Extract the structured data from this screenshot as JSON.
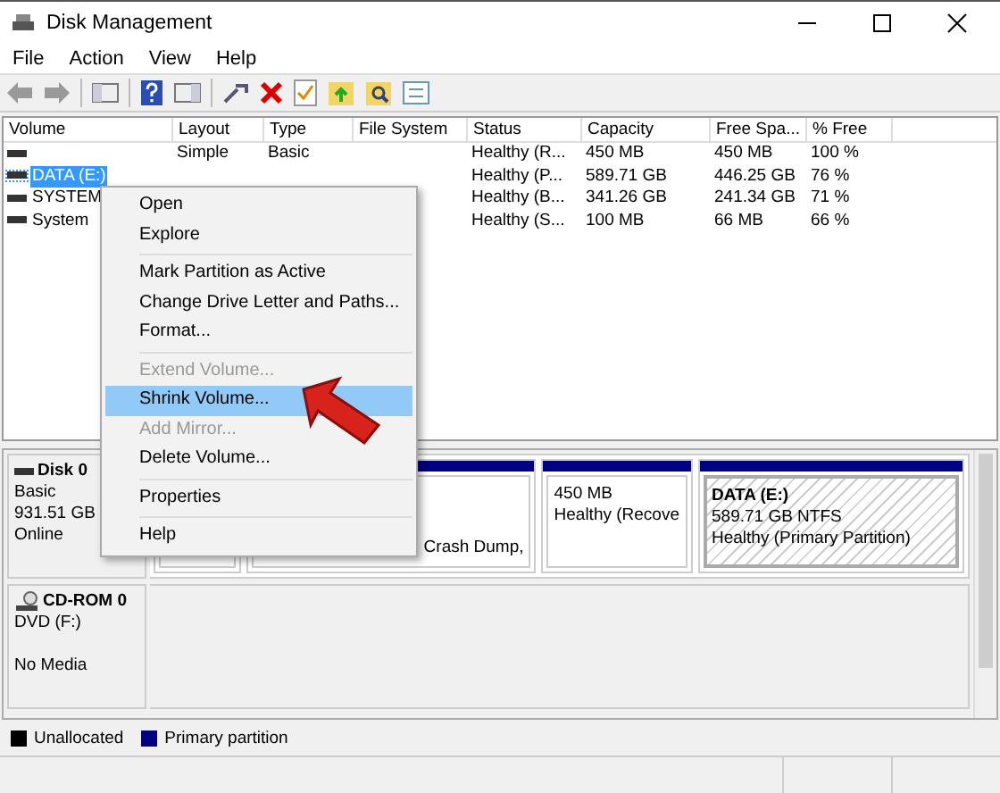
{
  "window": {
    "title": "Disk Management"
  },
  "menu_bar": [
    "File",
    "Action",
    "View",
    "Help"
  ],
  "volume_table": {
    "columns": [
      "Volume",
      "Layout",
      "Type",
      "File System",
      "Status",
      "Capacity",
      "Free Spa...",
      "% Free"
    ],
    "rows": [
      {
        "volume": null,
        "layout": "Simple",
        "type": "Basic",
        "file_system": null,
        "status": "Healthy (R...",
        "capacity": "450 MB",
        "free_space": "450 MB",
        "percent_free": "100 %",
        "selected": false
      },
      {
        "volume": "DATA (E:)",
        "status": "Healthy (P...",
        "capacity": "589.71 GB",
        "free_space": "446.25 GB",
        "percent_free": "76 %",
        "selected": true
      },
      {
        "volume": "SYSTEM",
        "status": "Healthy (B...",
        "capacity": "341.26 GB",
        "free_space": "241.34 GB",
        "percent_free": "71 %",
        "selected": false
      },
      {
        "volume": "System",
        "status": "Healthy (S...",
        "capacity": "100 MB",
        "free_space": "66 MB",
        "percent_free": "66 %",
        "selected": false
      }
    ]
  },
  "context_menu": [
    {
      "kind": "item",
      "label": "Open",
      "disabled": false,
      "selected": false
    },
    {
      "kind": "item",
      "label": "Explore",
      "disabled": false,
      "selected": false
    },
    {
      "kind": "separator"
    },
    {
      "kind": "item",
      "label": "Mark Partition as Active",
      "disabled": false,
      "selected": false
    },
    {
      "kind": "item",
      "label": "Change Drive Letter and Paths...",
      "disabled": false,
      "selected": false
    },
    {
      "kind": "item",
      "label": "Format...",
      "disabled": false,
      "selected": false
    },
    {
      "kind": "separator"
    },
    {
      "kind": "item",
      "label": "Extend Volume...",
      "disabled": true,
      "selected": false
    },
    {
      "kind": "item",
      "label": "Shrink Volume...",
      "disabled": false,
      "selected": true
    },
    {
      "kind": "item",
      "label": "Add Mirror...",
      "disabled": true,
      "selected": false
    },
    {
      "kind": "item",
      "label": "Delete Volume...",
      "disabled": false,
      "selected": false
    },
    {
      "kind": "separator"
    },
    {
      "kind": "item",
      "label": "Properties",
      "disabled": false,
      "selected": false
    },
    {
      "kind": "separator"
    },
    {
      "kind": "item",
      "label": "Help",
      "disabled": false,
      "selected": false
    }
  ],
  "disks": [
    {
      "kind": "disk",
      "name": "Disk 0",
      "lines": [
        "Basic",
        "931.51 GB",
        "Online"
      ],
      "partitions": [
        {
          "selected": false
        },
        {
          "lines": [
            "Crash Dump,"
          ],
          "selected": false
        },
        {
          "lines": [
            "450 MB",
            "Healthy (Recove"
          ],
          "selected": false
        },
        {
          "title": "DATA  (E:)",
          "lines": [
            "589.71 GB NTFS",
            "Healthy (Primary Partition)"
          ],
          "selected": true
        }
      ]
    },
    {
      "kind": "cdrom",
      "name": "CD-ROM 0",
      "lines": [
        "DVD (F:)",
        "No Media"
      ]
    }
  ],
  "legend": [
    {
      "label": "Unallocated",
      "color": "#000000"
    },
    {
      "label": "Primary partition",
      "color": "#000080"
    }
  ]
}
